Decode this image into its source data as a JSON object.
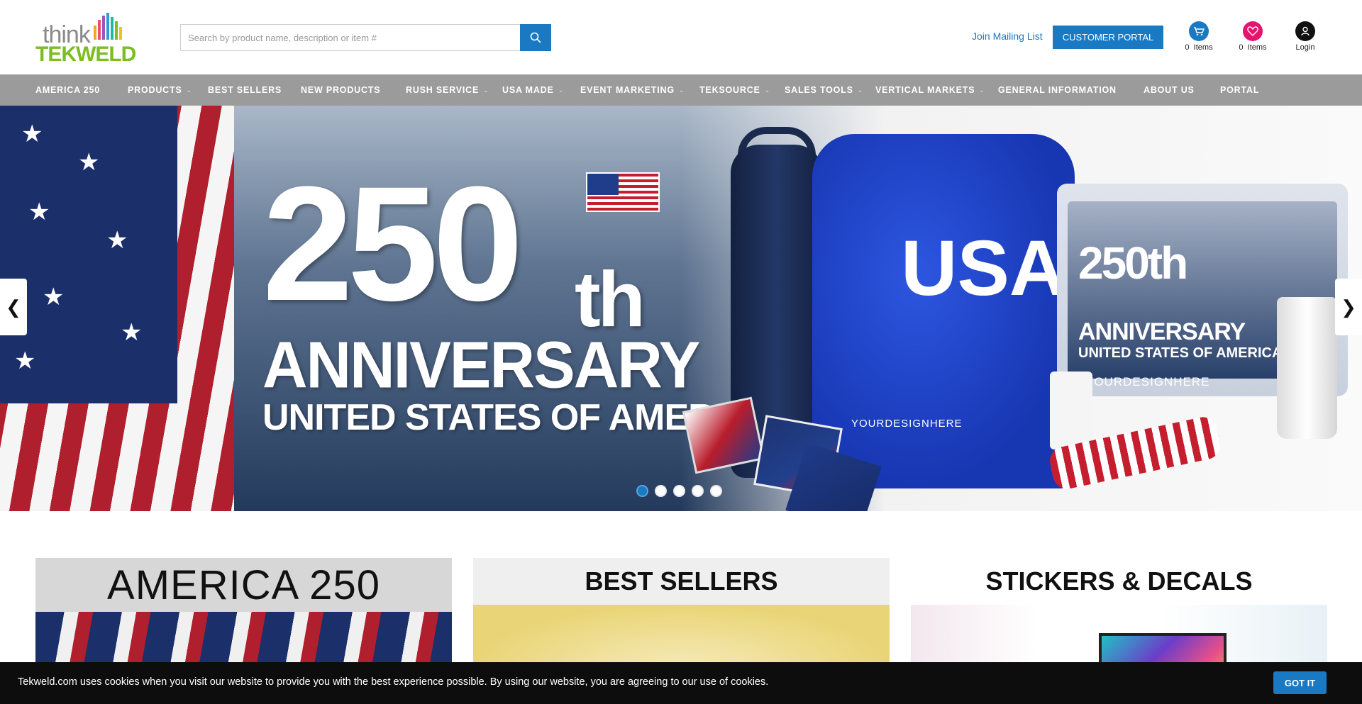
{
  "header": {
    "logo_think": "think",
    "logo_brand": "TEKWELD",
    "search_placeholder": "Search by product name, description or item #",
    "mailing_link": "Join Mailing List",
    "portal_button": "CUSTOMER PORTAL",
    "cart": {
      "count": "0",
      "label": "Items"
    },
    "wishlist": {
      "count": "0",
      "label": "Items"
    },
    "login": "Login"
  },
  "nav": {
    "items": [
      {
        "label": "AMERICA 250",
        "has_dropdown": false
      },
      {
        "label": "PRODUCTS",
        "has_dropdown": true
      },
      {
        "label": "BEST SELLERS",
        "has_dropdown": false
      },
      {
        "label": "NEW PRODUCTS",
        "has_dropdown": false
      },
      {
        "label": "RUSH SERVICE",
        "has_dropdown": true
      },
      {
        "label": "USA MADE",
        "has_dropdown": true
      },
      {
        "label": "EVENT MARKETING",
        "has_dropdown": true
      },
      {
        "label": "TEKSOURCE",
        "has_dropdown": true
      },
      {
        "label": "SALES TOOLS",
        "has_dropdown": true
      },
      {
        "label": "VERTICAL MARKETS",
        "has_dropdown": true
      },
      {
        "label": "GENERAL INFORMATION",
        "has_dropdown": false
      },
      {
        "label": "ABOUT US",
        "has_dropdown": false
      },
      {
        "label": "PORTAL",
        "has_dropdown": false
      }
    ]
  },
  "hero": {
    "number": "250",
    "suffix": "th",
    "line1": "ANNIVERSARY",
    "line2": "UNITED STATES OF AMERICA",
    "bag_text": "USA",
    "bag_sub": "YOURDESIGNHERE",
    "cooler_number": "250th",
    "cooler_line1": "ANNIVERSARY",
    "cooler_line2": "UNITED STATES OF AMERICA",
    "cooler_design": "YOURDESIGNHERE",
    "slide_count": 5,
    "active_slide": 1
  },
  "tiles": [
    {
      "title": "AMERICA 250"
    },
    {
      "title": "BEST SELLERS"
    },
    {
      "title": "STICKERS & DECALS"
    }
  ],
  "cookie": {
    "message": "Tekweld.com uses cookies when you visit our website to provide you with the best experience possible. By using our website, you are agreeing to our use of cookies.",
    "button": "GOT IT"
  },
  "colors": {
    "accent": "#1979c3",
    "nav_bg": "#9b9b9b",
    "brand_green": "#7bbd23",
    "wishlist_pink": "#e6136f"
  }
}
